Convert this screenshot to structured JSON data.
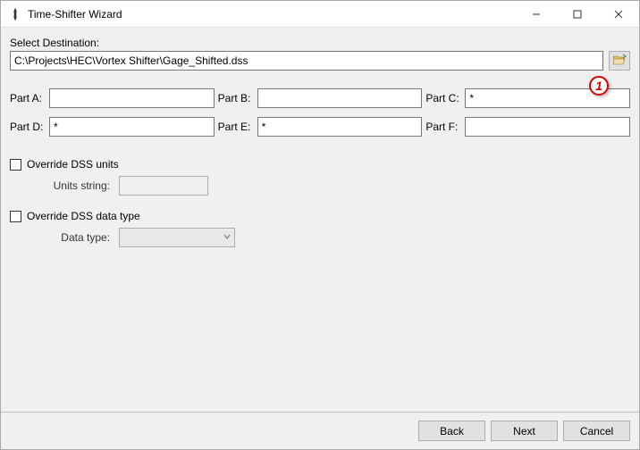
{
  "window": {
    "title": "Time-Shifter Wizard"
  },
  "labels": {
    "select_destination": "Select Destination:",
    "part_a": "Part A:",
    "part_b": "Part B:",
    "part_c": "Part C:",
    "part_d": "Part D:",
    "part_e": "Part E:",
    "part_f": "Part F:",
    "override_units": "Override DSS units",
    "units_string": "Units string:",
    "override_type": "Override DSS data type",
    "data_type": "Data type:"
  },
  "values": {
    "destination": "C:\\Projects\\HEC\\Vortex Shifter\\Gage_Shifted.dss",
    "part_a": "",
    "part_b": "",
    "part_c": "*",
    "part_d": "*",
    "part_e": "*",
    "part_f": "",
    "units_string": "",
    "data_type": ""
  },
  "callout": "1",
  "buttons": {
    "back": "Back",
    "next": "Next",
    "cancel": "Cancel"
  }
}
